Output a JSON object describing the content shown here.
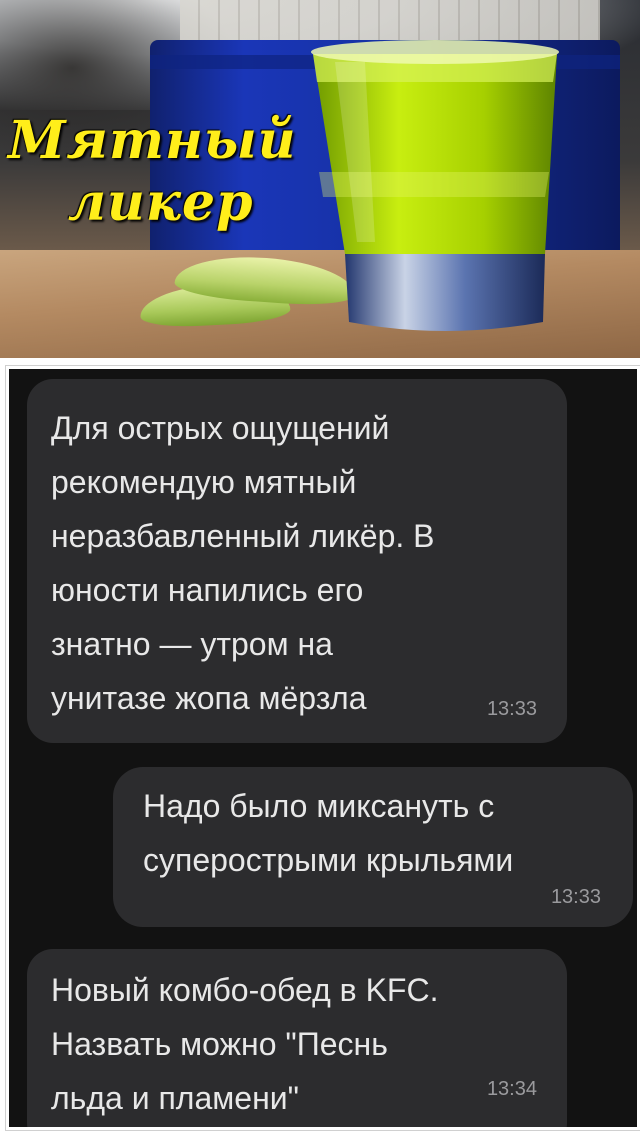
{
  "banner": {
    "title_line1": "Мятный",
    "title_line2": "ликер",
    "title_color": "#ffee1a",
    "liquid_color": "#a8d400"
  },
  "messages": [
    {
      "direction": "incoming",
      "text": "Для острых ощущений\nрекомендую мятный\nнеразбавленный ликёр. В\nюности напились его\nзнатно — утром на\nунитазе жопа мёрзла",
      "time": "13:33"
    },
    {
      "direction": "outgoing",
      "text": "Надо было миксануть с\nсуперострыми крыльями",
      "time": "13:33"
    },
    {
      "direction": "incoming",
      "text": "Новый комбо-обед в KFC.\nНазвать можно \"Песнь\nльда и пламени\"",
      "time": "13:34"
    }
  ],
  "colors": {
    "chat_background": "#121212",
    "bubble": "#2c2c2e",
    "message_text": "#e8e8e8",
    "timestamp": "#9a9a9d"
  }
}
